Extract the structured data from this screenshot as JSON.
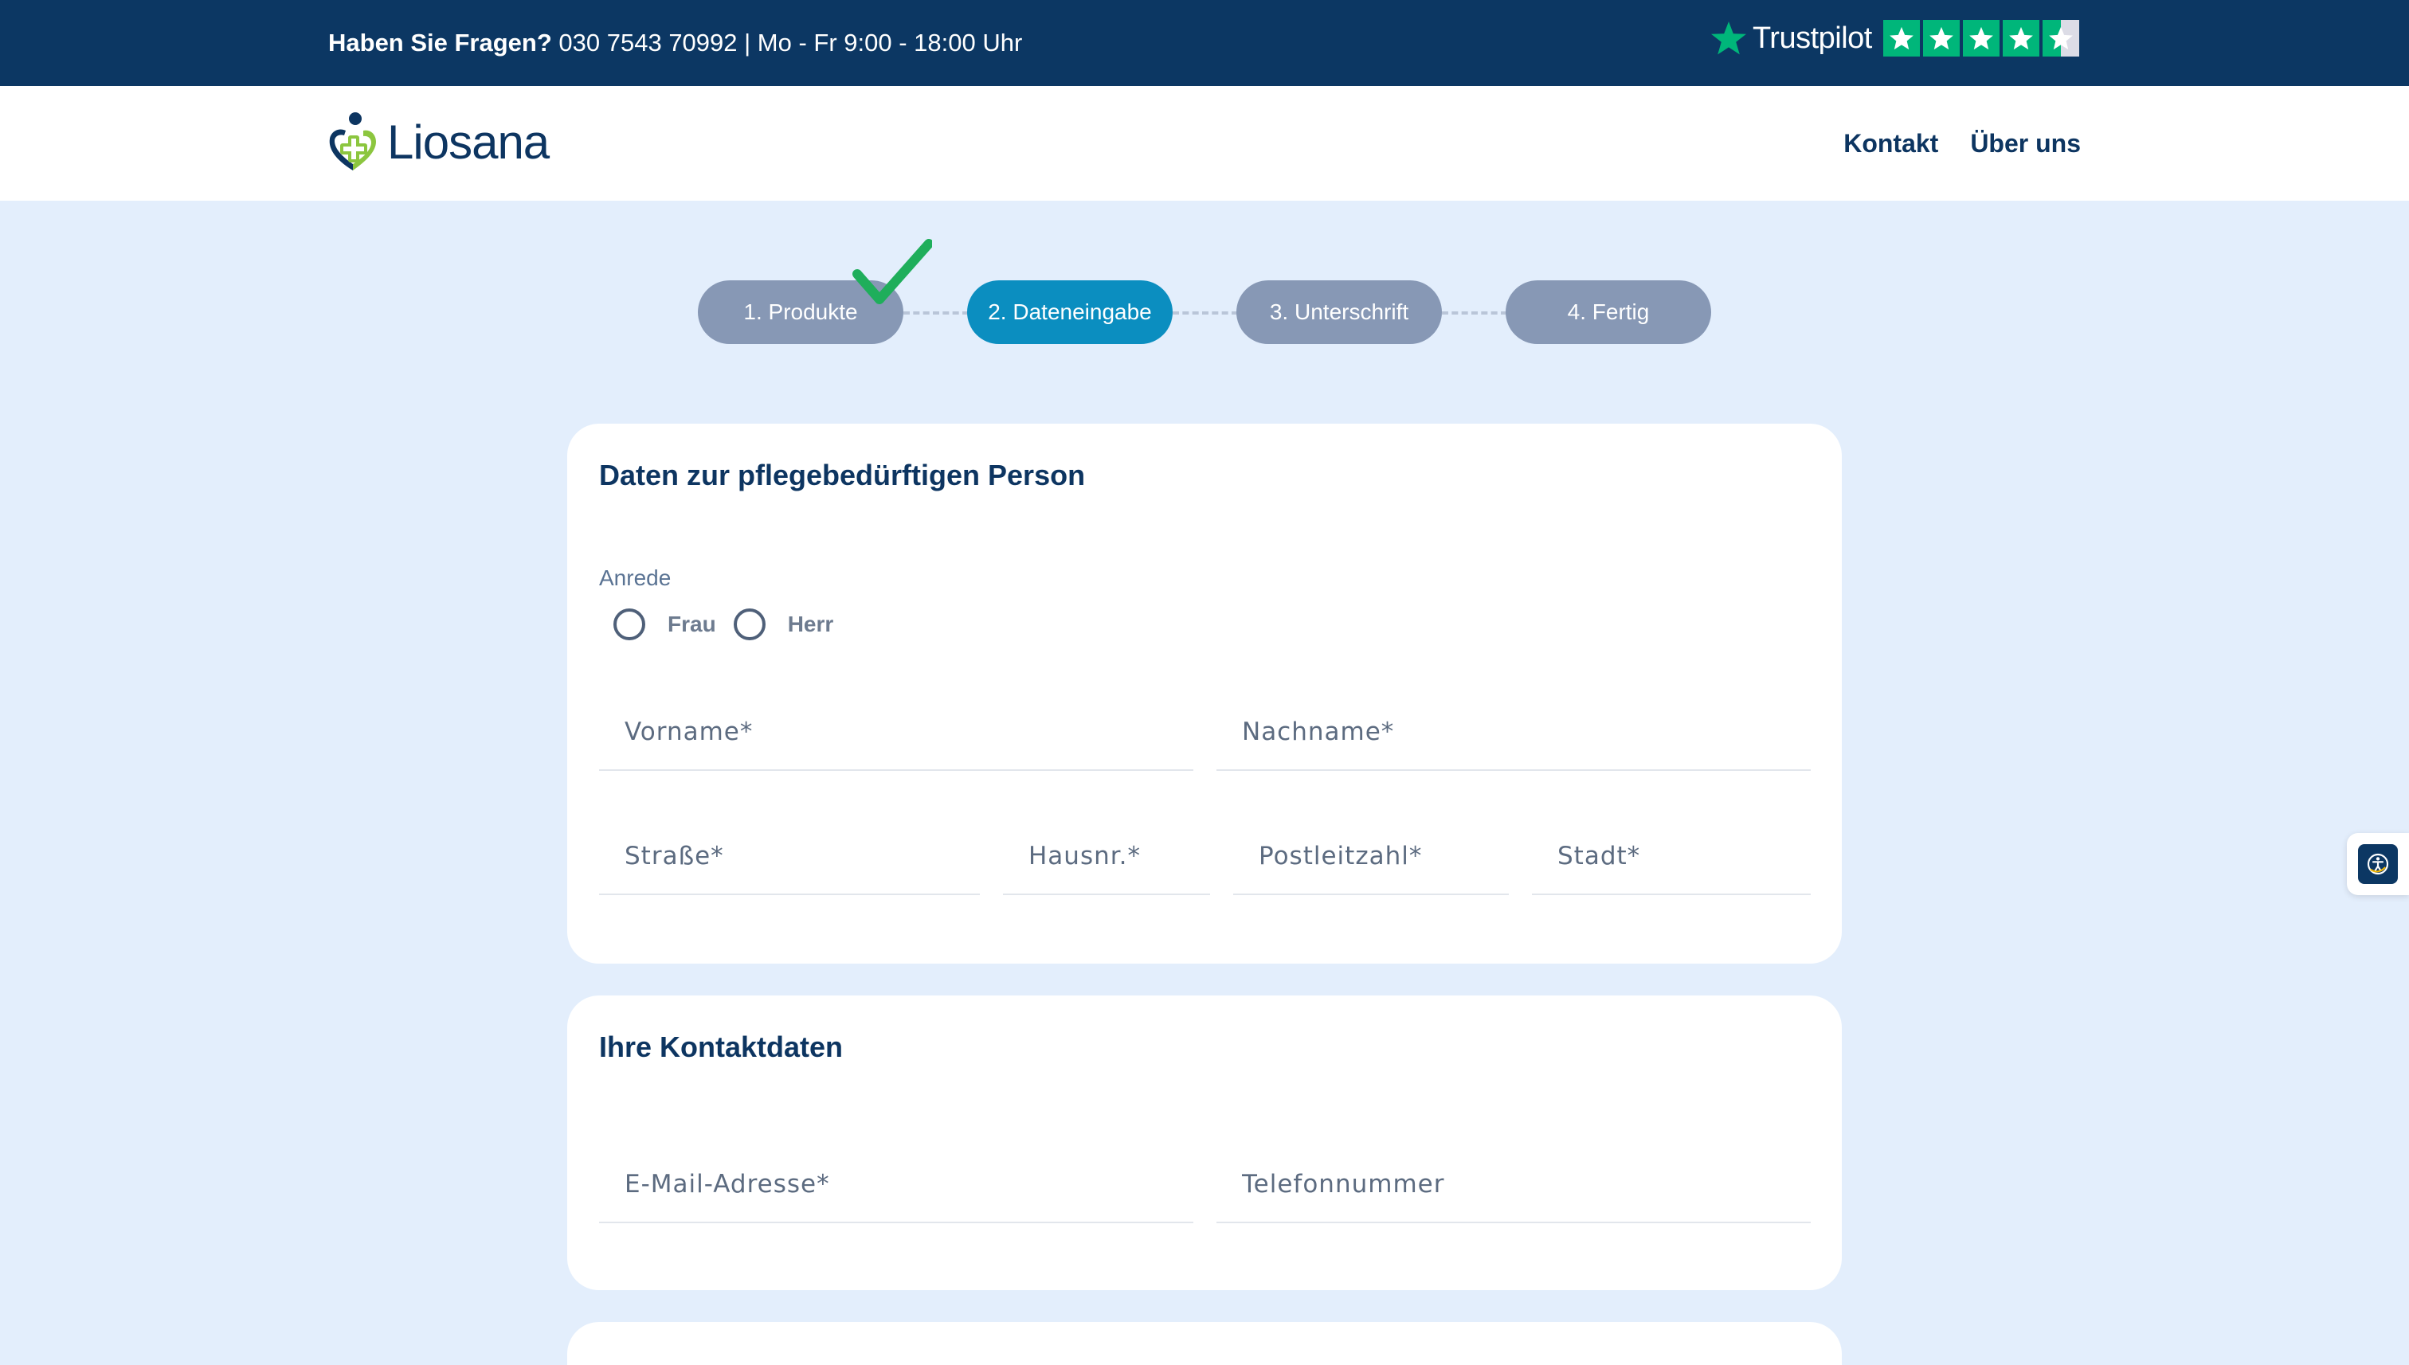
{
  "topbar": {
    "question": "Haben Sie Fragen?",
    "contact_info": " 030 7543 70992 | Mo - Fr 9:00 - 18:00 Uhr",
    "trustpilot_label": "Trustpilot",
    "trustpilot_rating_stars": 4.5
  },
  "header": {
    "logo_text": "Liosana",
    "nav": {
      "kontakt": "Kontakt",
      "ueber_uns": "Über uns"
    }
  },
  "stepper": {
    "steps": [
      {
        "label": "1. Produkte",
        "state": "completed"
      },
      {
        "label": "2. Dateneingabe",
        "state": "active"
      },
      {
        "label": "3. Unterschrift",
        "state": "upcoming"
      },
      {
        "label": "4. Fertig",
        "state": "upcoming"
      }
    ]
  },
  "person_card": {
    "title": "Daten zur pflegebedürftigen Person",
    "anrede_label": "Anrede",
    "anrede_options": [
      "Frau",
      "Herr"
    ],
    "fields": {
      "vorname": "Vorname*",
      "nachname": "Nachname*",
      "strasse": "Straße*",
      "hausnr": "Hausnr.*",
      "plz": "Postleitzahl*",
      "stadt": "Stadt*"
    }
  },
  "contact_card": {
    "title": "Ihre Kontaktdaten",
    "fields": {
      "email": "E-Mail-Adresse*",
      "telefon": "Telefonnummer"
    }
  },
  "colors": {
    "navy": "#0c3763",
    "page_bg": "#e3eefc",
    "step_active": "#0b8ec0",
    "step_inactive": "#8798b5",
    "check_green": "#1fae5b",
    "trustpilot_green": "#00b67a"
  },
  "icons": {
    "trustpilot_star": "star-icon",
    "checkmark": "checkmark-icon",
    "accessibility": "accessibility-icon"
  }
}
